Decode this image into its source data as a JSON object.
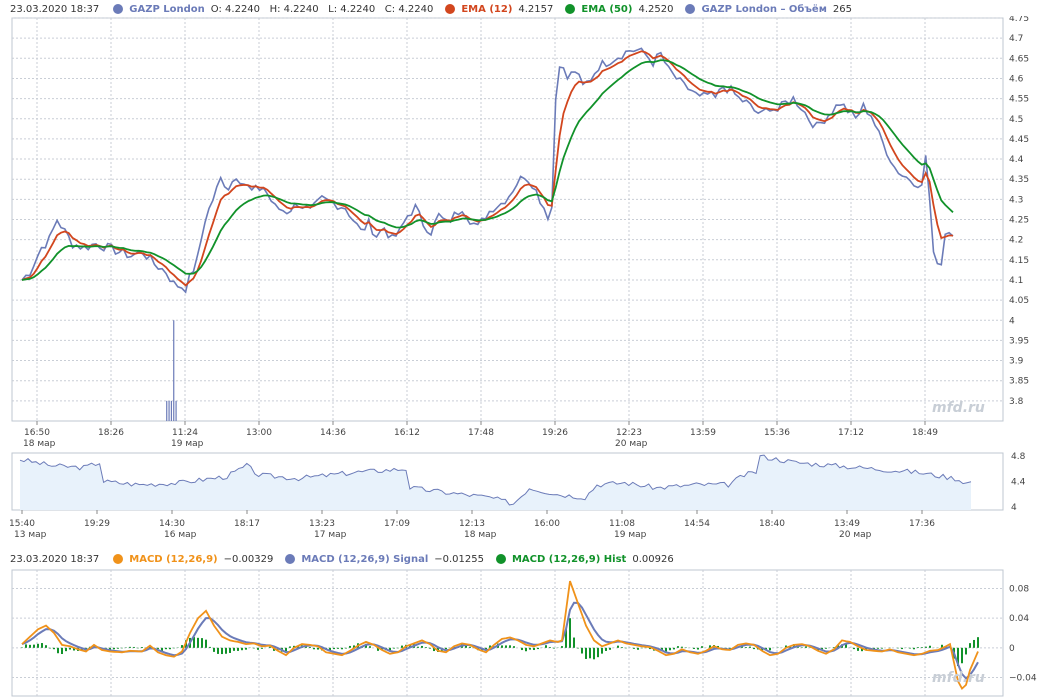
{
  "main": {
    "legend": {
      "timestamp": "23.03.2020 18:37",
      "items": [
        {
          "name": "GAZP London",
          "color": "#6b7bb8",
          "text": "O: 4.2240   H: 4.2240   L: 4.2240   C: 4.2240"
        },
        {
          "name": "EMA (12)",
          "color": "#d2461e",
          "text": "4.2157"
        },
        {
          "name": "EMA (50)",
          "color": "#11922a",
          "text": "4.2520"
        },
        {
          "name": "GAZP London – Объём",
          "color": "#6b7bb8",
          "text": "265"
        }
      ]
    },
    "watermark": "mfd.ru"
  },
  "macd": {
    "legend": {
      "timestamp": "23.03.2020 18:37",
      "items": [
        {
          "name": "MACD (12,26,9)",
          "color": "#f0921a",
          "text": "−0.00329"
        },
        {
          "name": "MACD (12,26,9) Signal",
          "color": "#6b7bb8",
          "text": "−0.01255"
        },
        {
          "name": "MACD (12,26,9) Hist",
          "color": "#11922a",
          "text": "0.00926"
        }
      ]
    },
    "watermark": "mfd.ru"
  },
  "colors": {
    "price": "#6b7bb8",
    "ema12": "#d2461e",
    "ema50": "#11922a",
    "macd": "#f0921a",
    "signal": "#6b7bb8",
    "hist": "#11922a",
    "grid": "#c9ced6",
    "nav_fill": "#e8f2fb"
  },
  "chart_data": [
    {
      "type": "line",
      "name": "price",
      "ylim": [
        3.75,
        4.75
      ],
      "yticks": [
        "4.75",
        "4.7",
        "4.65",
        "4.6",
        "4.55",
        "4.5",
        "4.45",
        "4.4",
        "4.35",
        "4.3",
        "4.25",
        "4.2",
        "4.15",
        "4.1",
        "4.05",
        "4",
        "3.95",
        "3.9",
        "3.85",
        "3.8"
      ],
      "xticks": [
        {
          "t": "16:50",
          "d": "18 мар"
        },
        {
          "t": "18:26",
          "d": ""
        },
        {
          "t": "11:24",
          "d": "19 мар"
        },
        {
          "t": "13:00",
          "d": ""
        },
        {
          "t": "14:36",
          "d": ""
        },
        {
          "t": "16:12",
          "d": ""
        },
        {
          "t": "17:48",
          "d": ""
        },
        {
          "t": "19:26",
          "d": ""
        },
        {
          "t": "12:23",
          "d": "20 мар"
        },
        {
          "t": "13:59",
          "d": ""
        },
        {
          "t": "15:36",
          "d": ""
        },
        {
          "t": "17:12",
          "d": ""
        },
        {
          "t": "18:49",
          "d": ""
        }
      ],
      "price_keys": [
        [
          0,
          4.1
        ],
        [
          2,
          4.12
        ],
        [
          5,
          4.18
        ],
        [
          7,
          4.2
        ],
        [
          9,
          4.25
        ],
        [
          11,
          4.22
        ],
        [
          13,
          4.19
        ],
        [
          16,
          4.18
        ],
        [
          19,
          4.19
        ],
        [
          22,
          4.18
        ],
        [
          25,
          4.17
        ],
        [
          28,
          4.16
        ],
        [
          31,
          4.17
        ],
        [
          34,
          4.14
        ],
        [
          37,
          4.12
        ],
        [
          39,
          4.09
        ],
        [
          42,
          4.08
        ],
        [
          45,
          4.15
        ],
        [
          47,
          4.25
        ],
        [
          49,
          4.3
        ],
        [
          51,
          4.35
        ],
        [
          53,
          4.33
        ],
        [
          55,
          4.36
        ],
        [
          57,
          4.34
        ],
        [
          59,
          4.32
        ],
        [
          62,
          4.33
        ],
        [
          65,
          4.28
        ],
        [
          68,
          4.27
        ],
        [
          71,
          4.29
        ],
        [
          74,
          4.27
        ],
        [
          77,
          4.3
        ],
        [
          80,
          4.29
        ],
        [
          83,
          4.28
        ],
        [
          85,
          4.25
        ],
        [
          87,
          4.22
        ],
        [
          89,
          4.24
        ],
        [
          91,
          4.21
        ],
        [
          93,
          4.23
        ],
        [
          95,
          4.2
        ],
        [
          97,
          4.22
        ],
        [
          99,
          4.26
        ],
        [
          101,
          4.28
        ],
        [
          103,
          4.24
        ],
        [
          105,
          4.22
        ],
        [
          107,
          4.26
        ],
        [
          109,
          4.24
        ],
        [
          111,
          4.26
        ],
        [
          113,
          4.28
        ],
        [
          115,
          4.25
        ],
        [
          117,
          4.23
        ],
        [
          119,
          4.26
        ],
        [
          121,
          4.28
        ],
        [
          123,
          4.29
        ],
        [
          125,
          4.31
        ],
        [
          127,
          4.34
        ],
        [
          129,
          4.36
        ],
        [
          131,
          4.34
        ],
        [
          133,
          4.3
        ],
        [
          135,
          4.26
        ],
        [
          136,
          4.28
        ],
        [
          137,
          4.55
        ],
        [
          138,
          4.64
        ],
        [
          140,
          4.6
        ],
        [
          142,
          4.62
        ],
        [
          144,
          4.58
        ],
        [
          146,
          4.6
        ],
        [
          148,
          4.63
        ],
        [
          150,
          4.64
        ],
        [
          152,
          4.65
        ],
        [
          154,
          4.66
        ],
        [
          156,
          4.67
        ],
        [
          158,
          4.67
        ],
        [
          160,
          4.66
        ],
        [
          162,
          4.64
        ],
        [
          164,
          4.66
        ],
        [
          166,
          4.62
        ],
        [
          168,
          4.6
        ],
        [
          170,
          4.58
        ],
        [
          172,
          4.57
        ],
        [
          174,
          4.55
        ],
        [
          176,
          4.56
        ],
        [
          178,
          4.55
        ],
        [
          180,
          4.58
        ],
        [
          182,
          4.57
        ],
        [
          184,
          4.55
        ],
        [
          186,
          4.54
        ],
        [
          188,
          4.52
        ],
        [
          190,
          4.51
        ],
        [
          192,
          4.53
        ],
        [
          194,
          4.52
        ],
        [
          196,
          4.54
        ],
        [
          198,
          4.55
        ],
        [
          200,
          4.53
        ],
        [
          202,
          4.5
        ],
        [
          204,
          4.48
        ],
        [
          206,
          4.5
        ],
        [
          208,
          4.52
        ],
        [
          210,
          4.54
        ],
        [
          212,
          4.52
        ],
        [
          214,
          4.5
        ],
        [
          216,
          4.53
        ],
        [
          218,
          4.51
        ],
        [
          220,
          4.46
        ],
        [
          222,
          4.42
        ],
        [
          224,
          4.38
        ],
        [
          226,
          4.36
        ],
        [
          228,
          4.35
        ],
        [
          230,
          4.34
        ],
        [
          231,
          4.33
        ],
        [
          232,
          4.41
        ],
        [
          233,
          4.3
        ],
        [
          234,
          4.16
        ],
        [
          236,
          4.14
        ],
        [
          237,
          4.22
        ],
        [
          239,
          4.22
        ]
      ],
      "volume_bars": [
        {
          "i": 37,
          "v": 3.8
        },
        {
          "i": 37.6,
          "v": 3.8
        },
        {
          "i": 38.2,
          "v": 3.8
        },
        {
          "i": 38.8,
          "v": 4
        },
        {
          "i": 39.4,
          "v": 3.8
        }
      ]
    },
    {
      "type": "area",
      "name": "navigator",
      "ylim": [
        3.95,
        4.85
      ],
      "yticks": [
        "4.8",
        "4.4",
        "4"
      ],
      "xticks": [
        {
          "t": "15:40",
          "d": "13 мар"
        },
        {
          "t": "19:29",
          "d": ""
        },
        {
          "t": "14:30",
          "d": "16 мар"
        },
        {
          "t": "18:17",
          "d": ""
        },
        {
          "t": "13:23",
          "d": "17 мар"
        },
        {
          "t": "17:09",
          "d": ""
        },
        {
          "t": "12:13",
          "d": "18 мар"
        },
        {
          "t": "16:00",
          "d": ""
        },
        {
          "t": "11:08",
          "d": "19 мар"
        },
        {
          "t": "14:54",
          "d": ""
        },
        {
          "t": "18:40",
          "d": ""
        },
        {
          "t": "13:49",
          "d": "20 мар"
        },
        {
          "t": "17:36",
          "d": ""
        }
      ],
      "nav_keys": [
        [
          0,
          4.75
        ],
        [
          8,
          4.65
        ],
        [
          16,
          4.62
        ],
        [
          20,
          4.7
        ],
        [
          21,
          4.4
        ],
        [
          30,
          4.35
        ],
        [
          40,
          4.38
        ],
        [
          52,
          4.48
        ],
        [
          57,
          4.65
        ],
        [
          60,
          4.5
        ],
        [
          70,
          4.45
        ],
        [
          85,
          4.55
        ],
        [
          97,
          4.6
        ],
        [
          98,
          4.3
        ],
        [
          108,
          4.22
        ],
        [
          118,
          4.15
        ],
        [
          124,
          4.05
        ],
        [
          128,
          4.3
        ],
        [
          135,
          4.2
        ],
        [
          142,
          4.15
        ],
        [
          145,
          4.35
        ],
        [
          152,
          4.38
        ],
        [
          160,
          4.3
        ],
        [
          170,
          4.35
        ],
        [
          178,
          4.35
        ],
        [
          182,
          4.5
        ],
        [
          185,
          4.55
        ],
        [
          186,
          4.8
        ],
        [
          195,
          4.7
        ],
        [
          205,
          4.65
        ],
        [
          215,
          4.6
        ],
        [
          225,
          4.55
        ],
        [
          235,
          4.45
        ],
        [
          238,
          4.38
        ],
        [
          240,
          4.4
        ]
      ]
    },
    {
      "type": "line",
      "name": "macd",
      "ylim": [
        -0.065,
        0.105
      ],
      "yticks": [
        "0.08",
        "0.04",
        "0",
        "−0.04"
      ],
      "macd_keys": [
        [
          0,
          0.005
        ],
        [
          2,
          0.015
        ],
        [
          4,
          0.025
        ],
        [
          6,
          0.03
        ],
        [
          8,
          0.02
        ],
        [
          10,
          0.004
        ],
        [
          12,
          0.002
        ],
        [
          14,
          -0.002
        ],
        [
          16,
          -0.005
        ],
        [
          18,
          0.004
        ],
        [
          20,
          -0.003
        ],
        [
          22,
          -0.005
        ],
        [
          25,
          -0.006
        ],
        [
          27,
          -0.004
        ],
        [
          30,
          -0.005
        ],
        [
          32,
          0.003
        ],
        [
          34,
          -0.006
        ],
        [
          36,
          -0.01
        ],
        [
          38,
          -0.012
        ],
        [
          40,
          -0.005
        ],
        [
          42,
          0.02
        ],
        [
          44,
          0.04
        ],
        [
          46,
          0.05
        ],
        [
          48,
          0.03
        ],
        [
          50,
          0.015
        ],
        [
          52,
          0.01
        ],
        [
          54,
          0.008
        ],
        [
          56,
          0.005
        ],
        [
          58,
          0.006
        ],
        [
          60,
          0.002
        ],
        [
          62,
          0.003
        ],
        [
          64,
          -0.004
        ],
        [
          66,
          -0.01
        ],
        [
          68,
          0.0
        ],
        [
          70,
          0.005
        ],
        [
          72,
          0.004
        ],
        [
          74,
          0.002
        ],
        [
          76,
          -0.006
        ],
        [
          78,
          -0.008
        ],
        [
          80,
          -0.01
        ],
        [
          82,
          -0.004
        ],
        [
          84,
          0.003
        ],
        [
          86,
          0.008
        ],
        [
          88,
          0.004
        ],
        [
          90,
          -0.003
        ],
        [
          92,
          -0.008
        ],
        [
          94,
          -0.006
        ],
        [
          96,
          0.002
        ],
        [
          98,
          0.006
        ],
        [
          100,
          0.01
        ],
        [
          102,
          0.005
        ],
        [
          104,
          -0.004
        ],
        [
          106,
          -0.006
        ],
        [
          108,
          0.002
        ],
        [
          110,
          0.006
        ],
        [
          112,
          0.004
        ],
        [
          114,
          -0.002
        ],
        [
          116,
          -0.006
        ],
        [
          118,
          0.004
        ],
        [
          120,
          0.012
        ],
        [
          122,
          0.014
        ],
        [
          124,
          0.01
        ],
        [
          126,
          0.004
        ],
        [
          128,
          0.002
        ],
        [
          130,
          0.006
        ],
        [
          132,
          0.01
        ],
        [
          134,
          0.008
        ],
        [
          135,
          0.01
        ],
        [
          136,
          0.05
        ],
        [
          137,
          0.09
        ],
        [
          139,
          0.06
        ],
        [
          141,
          0.03
        ],
        [
          143,
          0.01
        ],
        [
          145,
          0.002
        ],
        [
          147,
          0.006
        ],
        [
          149,
          0.01
        ],
        [
          151,
          0.006
        ],
        [
          153,
          0.004
        ],
        [
          155,
          0.002
        ],
        [
          157,
          0.001
        ],
        [
          159,
          -0.004
        ],
        [
          161,
          -0.01
        ],
        [
          163,
          -0.008
        ],
        [
          165,
          -0.002
        ],
        [
          167,
          -0.006
        ],
        [
          169,
          -0.008
        ],
        [
          171,
          -0.004
        ],
        [
          173,
          0.002
        ],
        [
          175,
          -0.002
        ],
        [
          177,
          -0.003
        ],
        [
          179,
          0.004
        ],
        [
          181,
          0.006
        ],
        [
          183,
          0.004
        ],
        [
          185,
          -0.004
        ],
        [
          187,
          -0.01
        ],
        [
          189,
          -0.008
        ],
        [
          191,
          0.0
        ],
        [
          193,
          0.004
        ],
        [
          195,
          0.005
        ],
        [
          197,
          0.002
        ],
        [
          199,
          -0.004
        ],
        [
          201,
          -0.008
        ],
        [
          203,
          -0.002
        ],
        [
          205,
          0.01
        ],
        [
          207,
          0.008
        ],
        [
          209,
          0.002
        ],
        [
          211,
          -0.003
        ],
        [
          213,
          -0.004
        ],
        [
          215,
          -0.005
        ],
        [
          217,
          -0.002
        ],
        [
          219,
          -0.006
        ],
        [
          221,
          -0.008
        ],
        [
          223,
          -0.01
        ],
        [
          225,
          -0.008
        ],
        [
          227,
          -0.004
        ],
        [
          229,
          -0.003
        ],
        [
          231,
          0.002
        ],
        [
          232,
          0.005
        ],
        [
          233,
          -0.02
        ],
        [
          234,
          -0.045
        ],
        [
          235,
          -0.055
        ],
        [
          236,
          -0.05
        ],
        [
          237,
          -0.03
        ],
        [
          239,
          -0.005
        ]
      ]
    }
  ]
}
